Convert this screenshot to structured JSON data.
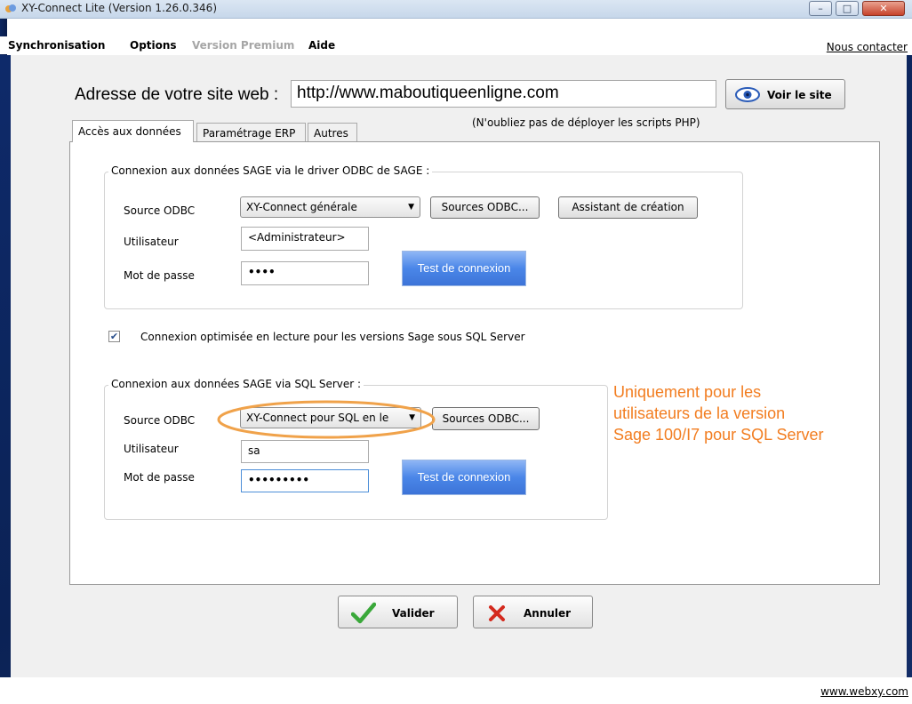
{
  "window": {
    "title": "XY-Connect Lite (Version 1.26.0.346)",
    "minimize": "–",
    "maximize": "□",
    "close": "✕"
  },
  "menu": {
    "items": [
      "Synchronisation",
      "Options",
      "Version Premium",
      "Aide"
    ],
    "contact": "Nous contacter"
  },
  "address": {
    "label": "Adresse de votre site web :",
    "value": "http://www.maboutiqueenligne.com",
    "view_button": "Voir le site",
    "hint": "(N'oubliez pas de déployer les scripts PHP)"
  },
  "tabs": [
    "Accès aux données",
    "Paramétrage ERP",
    "Autres"
  ],
  "odbc_group": {
    "legend": "Connexion aux données SAGE via le driver ODBC de SAGE :",
    "source_label": "Source ODBC",
    "source_value": "XY-Connect générale",
    "sources_button": "Sources ODBC...",
    "assistant_button": "Assistant de création",
    "user_label": "Utilisateur",
    "user_value": "<Administrateur>",
    "password_label": "Mot de passe",
    "password_value": "••••",
    "test_button": "Test de connexion"
  },
  "optimized": {
    "checked": true,
    "label": "Connexion optimisée en lecture pour les versions Sage sous SQL Server"
  },
  "sql_group": {
    "legend": "Connexion aux données SAGE via SQL Server :",
    "source_label": "Source ODBC",
    "source_value": "XY-Connect pour SQL en le",
    "sources_button": "Sources ODBC...",
    "user_label": "Utilisateur",
    "user_value": "sa",
    "password_label": "Mot de passe",
    "password_value": "•••••••••",
    "test_button": "Test de connexion"
  },
  "annotation": {
    "lines": [
      "Uniquement pour les",
      "utilisateurs de la version",
      "Sage 100/I7 pour SQL Server"
    ],
    "color": "#f27d20"
  },
  "actions": {
    "validate": "Valider",
    "cancel": "Annuler"
  },
  "footer": {
    "website": "www.webxy.com"
  }
}
